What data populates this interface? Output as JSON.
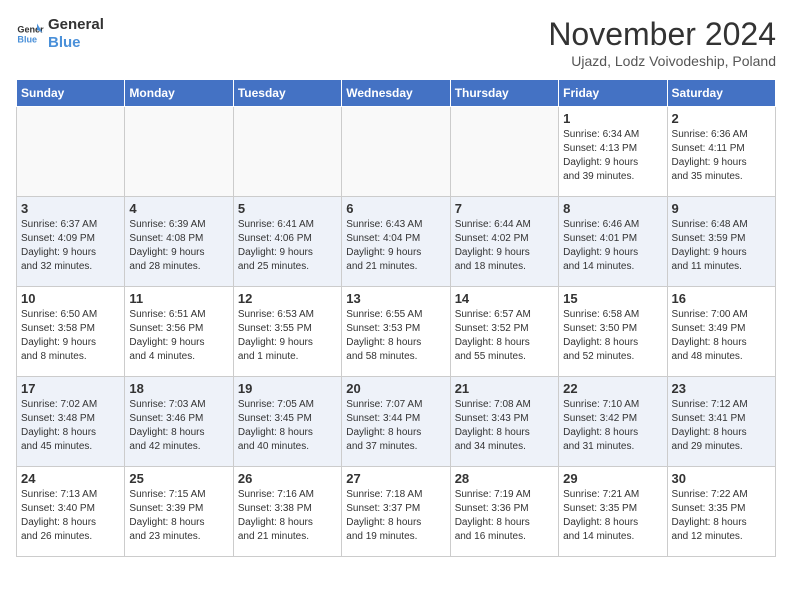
{
  "header": {
    "logo_line1": "General",
    "logo_line2": "Blue",
    "month_title": "November 2024",
    "location": "Ujazd, Lodz Voivodeship, Poland"
  },
  "weekdays": [
    "Sunday",
    "Monday",
    "Tuesday",
    "Wednesday",
    "Thursday",
    "Friday",
    "Saturday"
  ],
  "weeks": [
    [
      {
        "day": "",
        "info": ""
      },
      {
        "day": "",
        "info": ""
      },
      {
        "day": "",
        "info": ""
      },
      {
        "day": "",
        "info": ""
      },
      {
        "day": "",
        "info": ""
      },
      {
        "day": "1",
        "info": "Sunrise: 6:34 AM\nSunset: 4:13 PM\nDaylight: 9 hours\nand 39 minutes."
      },
      {
        "day": "2",
        "info": "Sunrise: 6:36 AM\nSunset: 4:11 PM\nDaylight: 9 hours\nand 35 minutes."
      }
    ],
    [
      {
        "day": "3",
        "info": "Sunrise: 6:37 AM\nSunset: 4:09 PM\nDaylight: 9 hours\nand 32 minutes."
      },
      {
        "day": "4",
        "info": "Sunrise: 6:39 AM\nSunset: 4:08 PM\nDaylight: 9 hours\nand 28 minutes."
      },
      {
        "day": "5",
        "info": "Sunrise: 6:41 AM\nSunset: 4:06 PM\nDaylight: 9 hours\nand 25 minutes."
      },
      {
        "day": "6",
        "info": "Sunrise: 6:43 AM\nSunset: 4:04 PM\nDaylight: 9 hours\nand 21 minutes."
      },
      {
        "day": "7",
        "info": "Sunrise: 6:44 AM\nSunset: 4:02 PM\nDaylight: 9 hours\nand 18 minutes."
      },
      {
        "day": "8",
        "info": "Sunrise: 6:46 AM\nSunset: 4:01 PM\nDaylight: 9 hours\nand 14 minutes."
      },
      {
        "day": "9",
        "info": "Sunrise: 6:48 AM\nSunset: 3:59 PM\nDaylight: 9 hours\nand 11 minutes."
      }
    ],
    [
      {
        "day": "10",
        "info": "Sunrise: 6:50 AM\nSunset: 3:58 PM\nDaylight: 9 hours\nand 8 minutes."
      },
      {
        "day": "11",
        "info": "Sunrise: 6:51 AM\nSunset: 3:56 PM\nDaylight: 9 hours\nand 4 minutes."
      },
      {
        "day": "12",
        "info": "Sunrise: 6:53 AM\nSunset: 3:55 PM\nDaylight: 9 hours\nand 1 minute."
      },
      {
        "day": "13",
        "info": "Sunrise: 6:55 AM\nSunset: 3:53 PM\nDaylight: 8 hours\nand 58 minutes."
      },
      {
        "day": "14",
        "info": "Sunrise: 6:57 AM\nSunset: 3:52 PM\nDaylight: 8 hours\nand 55 minutes."
      },
      {
        "day": "15",
        "info": "Sunrise: 6:58 AM\nSunset: 3:50 PM\nDaylight: 8 hours\nand 52 minutes."
      },
      {
        "day": "16",
        "info": "Sunrise: 7:00 AM\nSunset: 3:49 PM\nDaylight: 8 hours\nand 48 minutes."
      }
    ],
    [
      {
        "day": "17",
        "info": "Sunrise: 7:02 AM\nSunset: 3:48 PM\nDaylight: 8 hours\nand 45 minutes."
      },
      {
        "day": "18",
        "info": "Sunrise: 7:03 AM\nSunset: 3:46 PM\nDaylight: 8 hours\nand 42 minutes."
      },
      {
        "day": "19",
        "info": "Sunrise: 7:05 AM\nSunset: 3:45 PM\nDaylight: 8 hours\nand 40 minutes."
      },
      {
        "day": "20",
        "info": "Sunrise: 7:07 AM\nSunset: 3:44 PM\nDaylight: 8 hours\nand 37 minutes."
      },
      {
        "day": "21",
        "info": "Sunrise: 7:08 AM\nSunset: 3:43 PM\nDaylight: 8 hours\nand 34 minutes."
      },
      {
        "day": "22",
        "info": "Sunrise: 7:10 AM\nSunset: 3:42 PM\nDaylight: 8 hours\nand 31 minutes."
      },
      {
        "day": "23",
        "info": "Sunrise: 7:12 AM\nSunset: 3:41 PM\nDaylight: 8 hours\nand 29 minutes."
      }
    ],
    [
      {
        "day": "24",
        "info": "Sunrise: 7:13 AM\nSunset: 3:40 PM\nDaylight: 8 hours\nand 26 minutes."
      },
      {
        "day": "25",
        "info": "Sunrise: 7:15 AM\nSunset: 3:39 PM\nDaylight: 8 hours\nand 23 minutes."
      },
      {
        "day": "26",
        "info": "Sunrise: 7:16 AM\nSunset: 3:38 PM\nDaylight: 8 hours\nand 21 minutes."
      },
      {
        "day": "27",
        "info": "Sunrise: 7:18 AM\nSunset: 3:37 PM\nDaylight: 8 hours\nand 19 minutes."
      },
      {
        "day": "28",
        "info": "Sunrise: 7:19 AM\nSunset: 3:36 PM\nDaylight: 8 hours\nand 16 minutes."
      },
      {
        "day": "29",
        "info": "Sunrise: 7:21 AM\nSunset: 3:35 PM\nDaylight: 8 hours\nand 14 minutes."
      },
      {
        "day": "30",
        "info": "Sunrise: 7:22 AM\nSunset: 3:35 PM\nDaylight: 8 hours\nand 12 minutes."
      }
    ]
  ]
}
